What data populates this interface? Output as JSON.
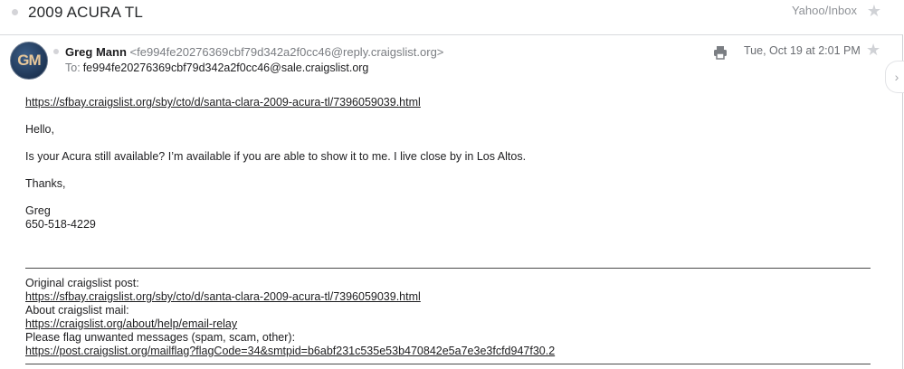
{
  "subject": "2009 ACURA TL",
  "folder": "Yahoo/Inbox",
  "message": {
    "avatar_initials": "GM",
    "sender_name": "Greg Mann",
    "sender_email": "<fe994fe20276369cbf79d342a2f0cc46@reply.craigslist.org>",
    "to_label": "To:",
    "to_address": "fe994fe20276369cbf79d342a2f0cc46@sale.craigslist.org",
    "date": "Tue, Oct 19 at 2:01 PM"
  },
  "body": {
    "listing_link": "https://sfbay.craigslist.org/sby/cto/d/santa-clara-2009-acura-tl/7396059039.html",
    "greeting": "Hello,",
    "paragraph": "Is your Acura still available?  I’m available if you are able to show it to me.  I live close by in Los Altos.",
    "signoff": "Thanks,",
    "name": "Greg",
    "phone": "650-518-4229"
  },
  "footer": {
    "original_label": "Original craigslist post:",
    "original_link": "https://sfbay.craigslist.org/sby/cto/d/santa-clara-2009-acura-tl/7396059039.html",
    "about_label": "About craigslist mail:",
    "about_link": "https://craigslist.org/about/help/email-relay",
    "flag_label": "Please flag unwanted messages (spam, scam, other):",
    "flag_link": "https://post.craigslist.org/mailflag?flagCode=34&smtpid=b6abf231c535e53b470842e5a7e3e3fcfd947f30.2"
  },
  "icons": {
    "print": "printer-icon",
    "star": "star-icon",
    "next": "chevron-right-icon"
  }
}
